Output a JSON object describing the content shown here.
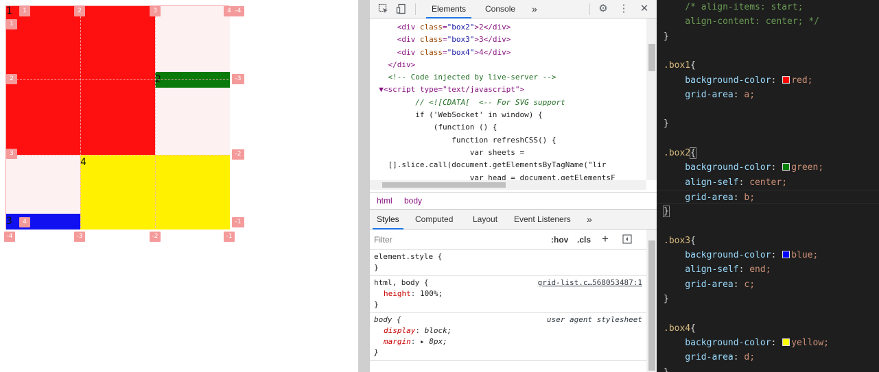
{
  "preview": {
    "cells": [
      {
        "name": "box1",
        "label": "1",
        "color": "#ff1010"
      },
      {
        "name": "box2",
        "label": "2",
        "color": "#0a7a0a"
      },
      {
        "name": "box3",
        "label": "3",
        "color": "#1010f0"
      },
      {
        "name": "box4",
        "label": "4",
        "color": "#fff100"
      }
    ],
    "col_badges_top": [
      "1",
      "2",
      "3",
      "4",
      "-4"
    ],
    "col_badges_bottom": [
      "-4",
      "-3",
      "-2",
      "-1"
    ],
    "row_badges_left": [
      "1",
      "2",
      "3",
      "4"
    ],
    "row_badges_right": [
      "-3",
      "-2",
      "-1"
    ]
  },
  "devtools": {
    "tabs": [
      "Elements",
      "Console"
    ],
    "more_tabs": "»",
    "dom_lines": [
      {
        "indent": "      ",
        "open": "<div ",
        "attr": "class",
        "val": "\"box2\"",
        "rest": ">2</div>"
      },
      {
        "indent": "      ",
        "open": "<div ",
        "attr": "class",
        "val": "\"box3\"",
        "rest": ">3</div>"
      },
      {
        "indent": "      ",
        "open": "<div ",
        "attr": "class",
        "val": "\"box4\"",
        "rest": ">4</div>"
      }
    ],
    "dom_close_div": "    </div>",
    "dom_comment": "    <!-- Code injected by live-server -->",
    "dom_script_open": "  ▼<script type=\"text/javascript\">",
    "dom_js": [
      "          // <![CDATA[  <-- For SVG support",
      "          if ('WebSocket' in window) {",
      "              (function () {",
      "                  function refreshCSS() {",
      "                      var sheets =",
      "    [].slice.call(document.getElementsByTagName(\"lir",
      "                      var head = document.getElementsF"
    ],
    "breadcrumbs": [
      "html",
      "body"
    ],
    "style_tabs": [
      "Styles",
      "Computed",
      "Layout",
      "Event Listeners"
    ],
    "style_more": "»",
    "filter_placeholder": "Filter",
    "hov": ":hov",
    "cls": ".cls",
    "rules": [
      {
        "selector": "element.style {",
        "source": "",
        "props": [],
        "close": "}"
      },
      {
        "selector": "html, body {",
        "source": "grid-list.c…568053487:1",
        "props": [
          {
            "name": "height",
            "value": "100%;"
          }
        ],
        "close": "}"
      },
      {
        "selector": "body {",
        "source": "user agent stylesheet",
        "props": [
          {
            "name": "display",
            "value": "block;"
          },
          {
            "name": "margin",
            "value": "▸ 8px;"
          }
        ],
        "close": "}"
      }
    ]
  },
  "editor": {
    "lines": [
      {
        "kind": "comment",
        "text": "    /* align-items: start;"
      },
      {
        "kind": "comment",
        "text": "    align-content: center; */"
      },
      {
        "kind": "plain",
        "text": "}"
      },
      {
        "kind": "blank",
        "text": ""
      },
      {
        "kind": "selector",
        "text": ".box1{"
      },
      {
        "kind": "decl",
        "prop": "    background-color",
        "swatch": "#ff0000",
        "value": "red;"
      },
      {
        "kind": "decl",
        "prop": "    grid-area",
        "value": "a;"
      },
      {
        "kind": "blank",
        "text": ""
      },
      {
        "kind": "plain",
        "text": "}"
      },
      {
        "kind": "blank",
        "text": ""
      },
      {
        "kind": "selector",
        "text": ".box2{"
      },
      {
        "kind": "decl",
        "prop": "    background-color",
        "swatch": "#008000",
        "value": "green;"
      },
      {
        "kind": "decl",
        "prop": "    align-self",
        "value": "center;"
      },
      {
        "kind": "decl",
        "prop": "    grid-area",
        "value": "b;"
      },
      {
        "kind": "plain",
        "text": "}"
      },
      {
        "kind": "blank",
        "text": ""
      },
      {
        "kind": "selector",
        "text": ".box3{"
      },
      {
        "kind": "decl",
        "prop": "    background-color",
        "swatch": "#0000ff",
        "value": "blue;"
      },
      {
        "kind": "decl",
        "prop": "    align-self",
        "value": "end;"
      },
      {
        "kind": "decl",
        "prop": "    grid-area",
        "value": "c;"
      },
      {
        "kind": "plain",
        "text": "}"
      },
      {
        "kind": "blank",
        "text": ""
      },
      {
        "kind": "selector",
        "text": ".box4{"
      },
      {
        "kind": "decl",
        "prop": "    background-color",
        "swatch": "#ffff00",
        "value": "yellow;"
      },
      {
        "kind": "decl",
        "prop": "    grid-area",
        "value": "d;"
      },
      {
        "kind": "plain",
        "text": "}"
      }
    ]
  }
}
